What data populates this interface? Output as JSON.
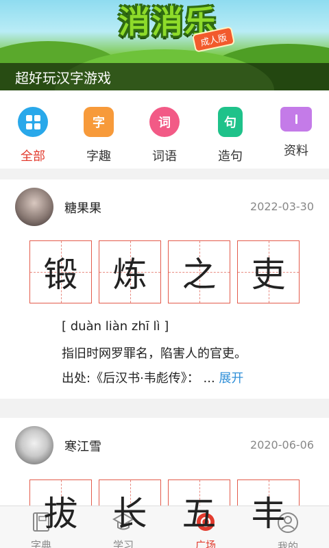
{
  "banner": {
    "logo_text": "消消乐",
    "badge": "成人版",
    "caption": "超好玩汉字游戏"
  },
  "categories": [
    {
      "label": "全部",
      "icon": "grid-icon",
      "icon_text": "",
      "active": true,
      "color": "#29a8ea"
    },
    {
      "label": "字趣",
      "icon": "zi-icon",
      "icon_text": "字",
      "active": false,
      "color": "#f79a3a"
    },
    {
      "label": "词语",
      "icon": "ci-bubble-icon",
      "icon_text": "词",
      "active": false,
      "color": "#f25a86"
    },
    {
      "label": "造句",
      "icon": "ju-doc-icon",
      "icon_text": "句",
      "active": false,
      "color": "#1fc28a"
    },
    {
      "label": "资料",
      "icon": "book-icon",
      "icon_text": "",
      "active": false,
      "color": "#c47be8"
    }
  ],
  "posts": [
    {
      "user": "糖果果",
      "date": "2022-03-30",
      "chars": [
        "锻",
        "炼",
        "之",
        "吏"
      ],
      "pinyin": "[ duàn liàn zhī lì ]",
      "meaning": "指旧时网罗罪名，陷害人的官吏。",
      "source": "出处:《后汉书·韦彪传》：  ...",
      "expand": "展开"
    },
    {
      "user": "寒江雪",
      "date": "2020-06-06",
      "chars": [
        "拔",
        "长",
        "五",
        "丰"
      ]
    }
  ],
  "nav": [
    {
      "label": "字典",
      "icon": "dictionary-icon",
      "active": false
    },
    {
      "label": "学习",
      "icon": "graduation-cap-icon",
      "active": false
    },
    {
      "label": "广场",
      "icon": "plaza-icon",
      "active": true
    },
    {
      "label": "我的",
      "icon": "user-icon",
      "active": false
    }
  ],
  "colors": {
    "accent": "#e23b2e",
    "link": "#2f8fd8",
    "tile_border": "#e35a4a"
  }
}
